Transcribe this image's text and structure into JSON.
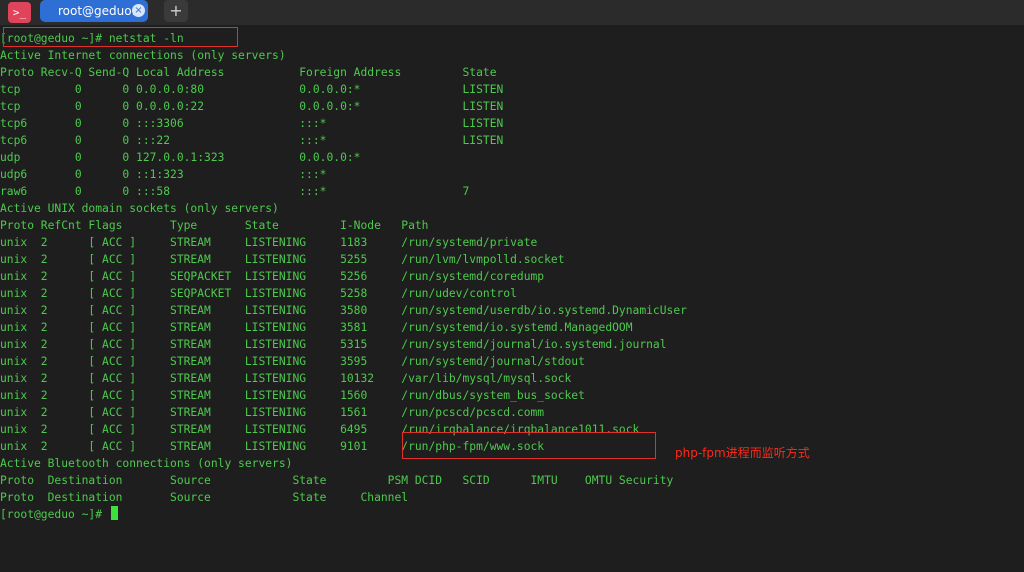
{
  "tabbar": {
    "app_icon_glyph": ">_",
    "tab_title": "root@geduo:~",
    "tab_close_glyph": "×",
    "new_tab_glyph": "+"
  },
  "terminal": {
    "lines": [
      "[root@geduo ~]# netstat -ln",
      "Active Internet connections (only servers)",
      "Proto Recv-Q Send-Q Local Address           Foreign Address         State",
      "tcp        0      0 0.0.0.0:80              0.0.0.0:*               LISTEN",
      "tcp        0      0 0.0.0.0:22              0.0.0.0:*               LISTEN",
      "tcp6       0      0 :::3306                 :::*                    LISTEN",
      "tcp6       0      0 :::22                   :::*                    LISTEN",
      "udp        0      0 127.0.0.1:323           0.0.0.0:*",
      "udp6       0      0 ::1:323                 :::*",
      "raw6       0      0 :::58                   :::*                    7",
      "Active UNIX domain sockets (only servers)",
      "Proto RefCnt Flags       Type       State         I-Node   Path",
      "unix  2      [ ACC ]     STREAM     LISTENING     1183     /run/systemd/private",
      "unix  2      [ ACC ]     STREAM     LISTENING     5255     /run/lvm/lvmpolld.socket",
      "unix  2      [ ACC ]     SEQPACKET  LISTENING     5256     /run/systemd/coredump",
      "unix  2      [ ACC ]     SEQPACKET  LISTENING     5258     /run/udev/control",
      "unix  2      [ ACC ]     STREAM     LISTENING     3580     /run/systemd/userdb/io.systemd.DynamicUser",
      "unix  2      [ ACC ]     STREAM     LISTENING     3581     /run/systemd/io.systemd.ManagedOOM",
      "unix  2      [ ACC ]     STREAM     LISTENING     5315     /run/systemd/journal/io.systemd.journal",
      "unix  2      [ ACC ]     STREAM     LISTENING     3595     /run/systemd/journal/stdout",
      "unix  2      [ ACC ]     STREAM     LISTENING     10132    /var/lib/mysql/mysql.sock",
      "unix  2      [ ACC ]     STREAM     LISTENING     1560     /run/dbus/system_bus_socket",
      "unix  2      [ ACC ]     STREAM     LISTENING     1561     /run/pcscd/pcscd.comm",
      "unix  2      [ ACC ]     STREAM     LISTENING     6495     /run/irqbalance/irqbalance1011.sock",
      "unix  2      [ ACC ]     STREAM     LISTENING     9101     /run/php-fpm/www.sock",
      "Active Bluetooth connections (only servers)",
      "Proto  Destination       Source            State         PSM DCID   SCID      IMTU    OMTU Security",
      "Proto  Destination       Source            State     Channel",
      "[root@geduo ~]# "
    ]
  },
  "annotation": {
    "text": "php-fpm进程而监听方式",
    "color": "#ff2a1a"
  },
  "colors": {
    "terminal_text": "#4ec94e",
    "background": "#1e1e1e",
    "tab_active": "#2e6fd6",
    "highlight_box": "#e0302a"
  }
}
